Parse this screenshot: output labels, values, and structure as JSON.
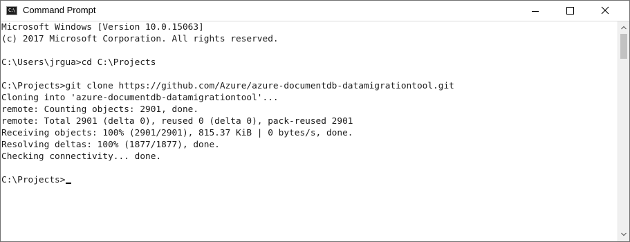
{
  "window": {
    "title": "Command Prompt",
    "icon": "cmd-icon",
    "controls": {
      "minimize_icon": "minimize-icon",
      "maximize_icon": "maximize-icon",
      "close_icon": "close-icon"
    }
  },
  "console": {
    "lines": [
      "Microsoft Windows [Version 10.0.15063]",
      "(c) 2017 Microsoft Corporation. All rights reserved.",
      "",
      "C:\\Users\\jrgua>cd C:\\Projects",
      "",
      "C:\\Projects>git clone https://github.com/Azure/azure-documentdb-datamigrationtool.git",
      "Cloning into 'azure-documentdb-datamigrationtool'...",
      "remote: Counting objects: 2901, done.",
      "remote: Total 2901 (delta 0), reused 0 (delta 0), pack-reused 2901",
      "Receiving objects: 100% (2901/2901), 815.37 KiB | 0 bytes/s, done.",
      "Resolving deltas: 100% (1877/1877), done.",
      "Checking connectivity... done.",
      "",
      "C:\\Projects>"
    ]
  },
  "colors": {
    "background": "#ffffff",
    "text": "#1a1a1a",
    "scrollbar_track": "#f0f0f0",
    "scrollbar_thumb": "#c2c2c2"
  }
}
